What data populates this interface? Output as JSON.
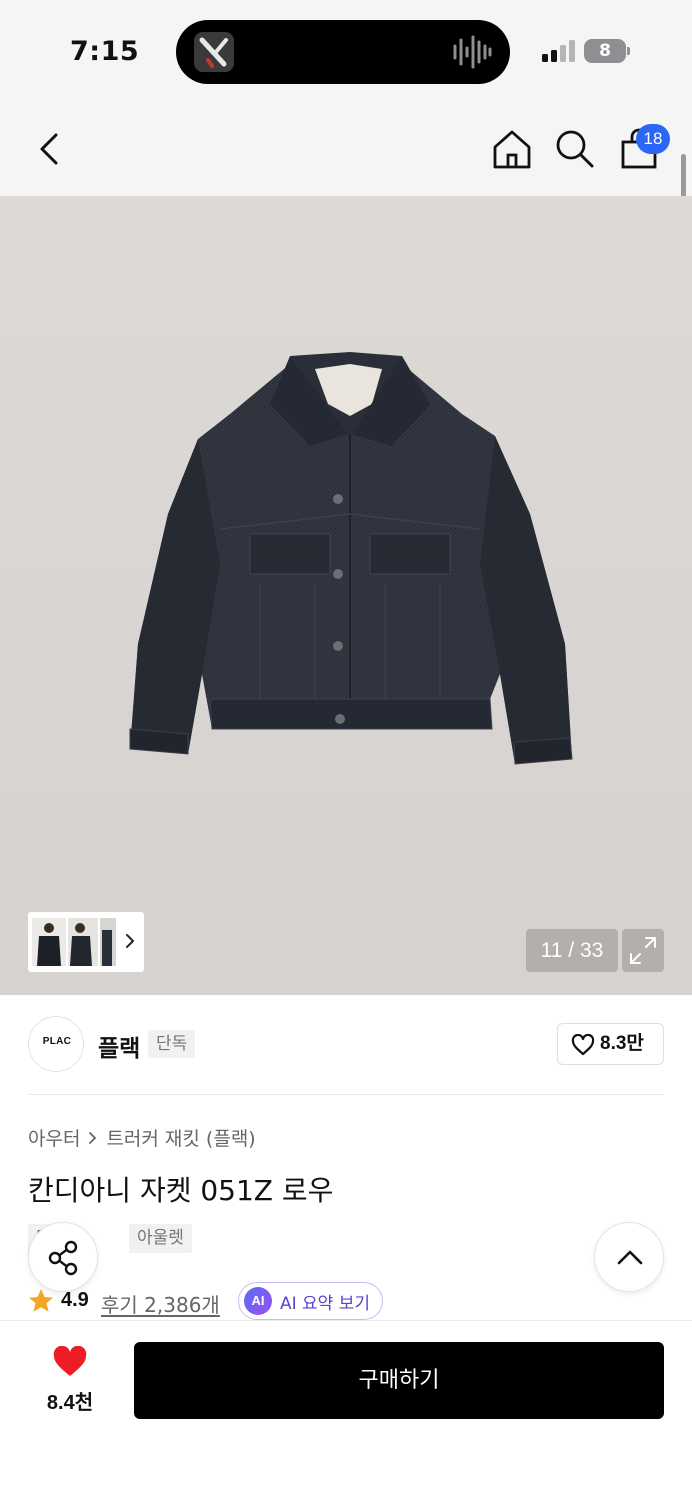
{
  "status_bar": {
    "time": "7:15",
    "battery": "8"
  },
  "header": {
    "cart_count": "18",
    "icons": [
      "back-icon",
      "home-icon",
      "search-icon",
      "shopping-bag-icon"
    ]
  },
  "gallery": {
    "counter": "11 / 33",
    "colors": {
      "background": "#d9d6d3",
      "jacket": "#2a2d36"
    }
  },
  "brand": {
    "logo_text": "PLAC",
    "name": "플랙",
    "tag": "단독",
    "likes": "8.3만"
  },
  "product": {
    "breadcrumb": [
      "아우터",
      "트러커 재킷 (플랙)"
    ],
    "title": "칸디아니 자켓 051Z 로우",
    "tags": [
      "단독",
      "아울렛"
    ],
    "rating": "4.9",
    "reviews": "후기 2,386개",
    "ai_badge": "AI",
    "ai_label": "AI 요약 보기"
  },
  "bottom": {
    "wish_count": "8.4천",
    "buy_label": "구매하기",
    "colors": {
      "heart": "#ee1c25",
      "buy": "#000000",
      "accent": "#2b66f6"
    }
  }
}
